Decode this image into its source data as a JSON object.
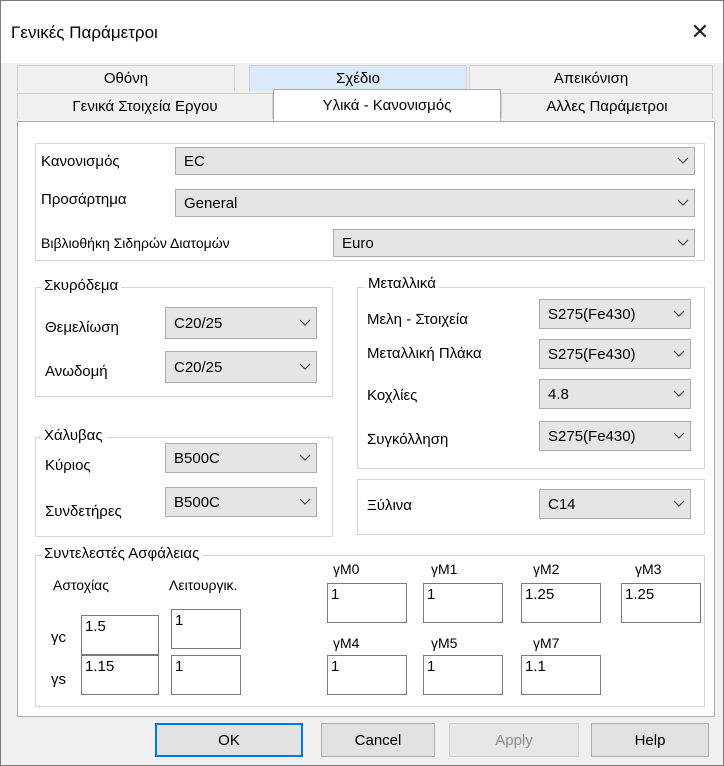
{
  "window": {
    "title": "Γενικές Παράμετροι"
  },
  "tabs": {
    "row1": [
      "Οθόνη",
      "Σχέδιο",
      "Απεικόνιση"
    ],
    "row2": [
      "Γενικά Στοιχεία Εργου",
      "Υλικά - Κανονισμός",
      "Αλλες Παράμετροι"
    ],
    "active": "Υλικά - Κανονισμός"
  },
  "code": {
    "kanonismos": {
      "label": "Κανονισμός",
      "value": "EC"
    },
    "prosartima": {
      "label": "Προσάρτημα",
      "value": "General"
    },
    "vivliothiki": {
      "label": "Βιβλιοθήκη Σιδηρών Διατομών",
      "value": "Euro"
    }
  },
  "concrete": {
    "title": "Σκυρόδεμα",
    "themeliosi": {
      "label": "Θεμελίωση",
      "value": "C20/25"
    },
    "anodomi": {
      "label": "Ανωδομή",
      "value": "C20/25"
    }
  },
  "steel": {
    "title": "Χάλυβας",
    "kyrios": {
      "label": "Κύριος",
      "value": "B500C"
    },
    "syndetires": {
      "label": "Συνδετήρες",
      "value": "B500C"
    }
  },
  "metal": {
    "title": "Μεταλλικά",
    "meli": {
      "label": "Μελη - Στοιχεία",
      "value": "S275(Fe430)"
    },
    "plaka": {
      "label": "Μεταλλική Πλάκα",
      "value": "S275(Fe430)"
    },
    "koxlies": {
      "label": "Κοχλίες",
      "value": "4.8"
    },
    "sygkollisi": {
      "label": "Συγκόλληση",
      "value": "S275(Fe430)"
    }
  },
  "wood": {
    "label": "Ξύλινα",
    "value": "C14"
  },
  "safety": {
    "title": "Συντελεστές Ασφάλειας",
    "col_astoxias": "Αστοχίας",
    "col_leitourgik": "Λειτουργικ.",
    "gc": {
      "label": "γc",
      "astoxias": "1.5",
      "leitourgik": "1"
    },
    "gs": {
      "label": "γs",
      "astoxias": "1.15",
      "leitourgik": "1"
    },
    "gm0": {
      "label": "γM0",
      "value": "1"
    },
    "gm1": {
      "label": "γM1",
      "value": "1"
    },
    "gm2": {
      "label": "γM2",
      "value": "1.25"
    },
    "gm3": {
      "label": "γM3",
      "value": "1.25"
    },
    "gm4": {
      "label": "γM4",
      "value": "1"
    },
    "gm5": {
      "label": "γM5",
      "value": "1"
    },
    "gm7": {
      "label": "γM7",
      "value": "1.1"
    }
  },
  "buttons": {
    "ok": "OK",
    "cancel": "Cancel",
    "apply": "Apply",
    "help": "Help"
  },
  "icons": {
    "close": "close-icon",
    "dropdown": "chevron-down-icon"
  }
}
